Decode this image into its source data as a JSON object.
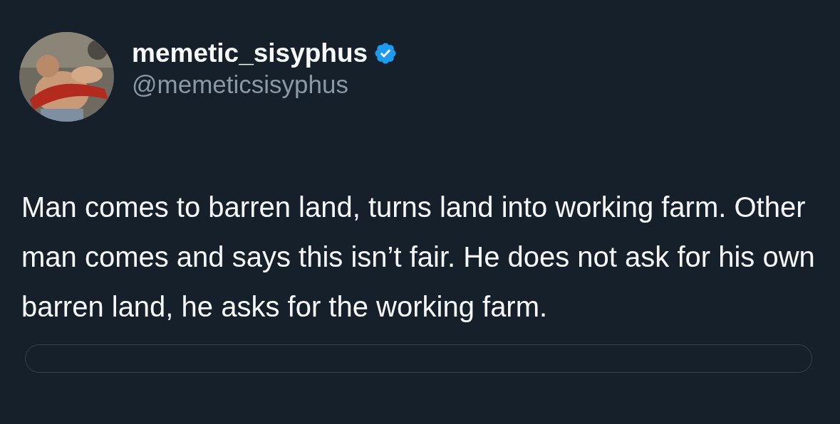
{
  "author": {
    "name": "memetic_sisyphus",
    "handle": "@memeticsisyphus",
    "verified": true
  },
  "text": "Man comes to barren land, turns land into working farm. Other man comes and says this isn’t fair. He does not ask for his own barren land, he asks for the working farm."
}
